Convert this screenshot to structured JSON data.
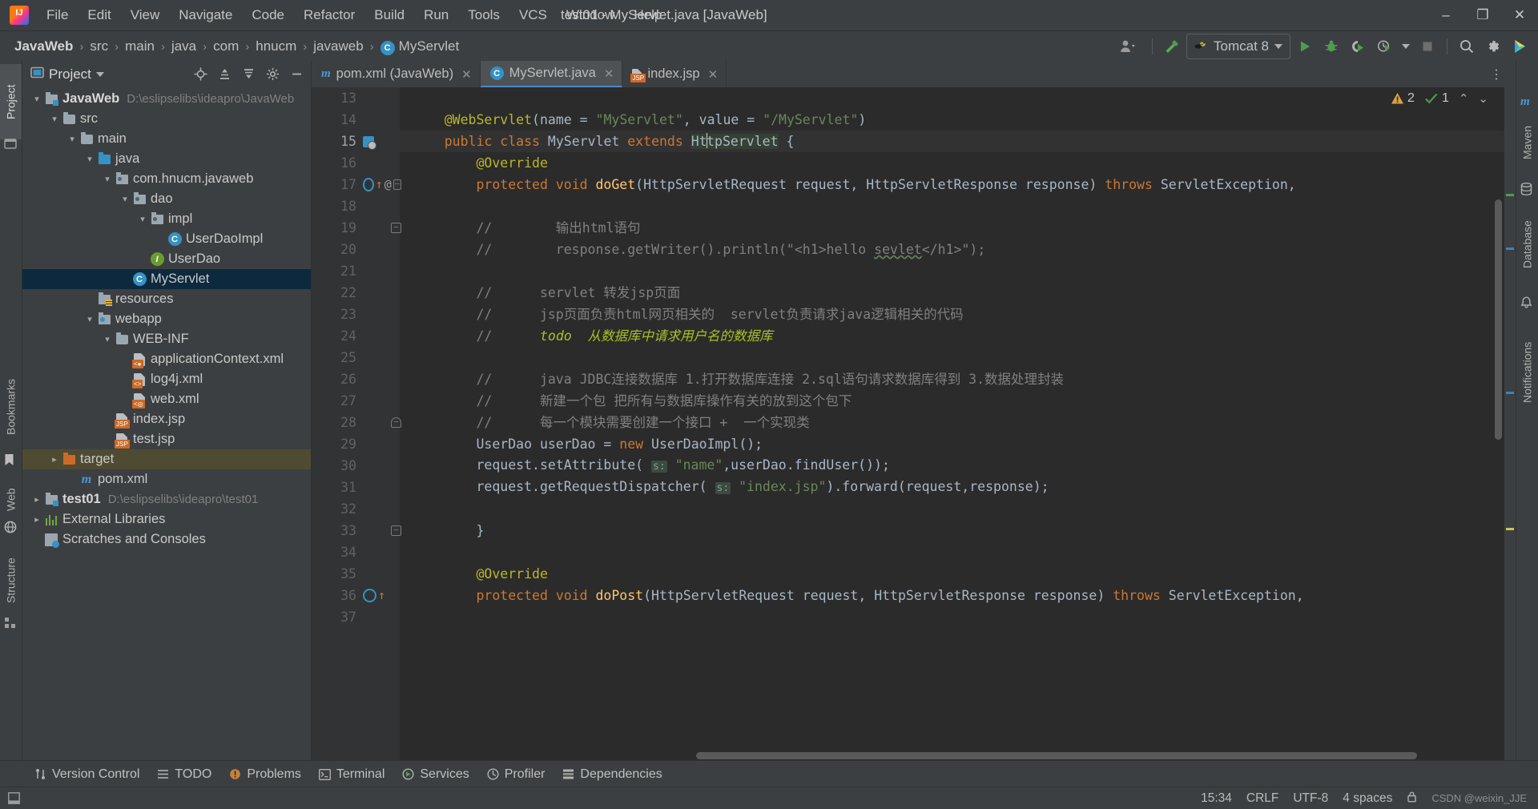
{
  "window": {
    "title": "test01 - MyServlet.java [JavaWeb]",
    "minimize": "–",
    "maximize": "❐",
    "close": "✕"
  },
  "menu": [
    {
      "label": "File"
    },
    {
      "label": "Edit"
    },
    {
      "label": "View"
    },
    {
      "label": "Navigate"
    },
    {
      "label": "Code"
    },
    {
      "label": "Refactor"
    },
    {
      "label": "Build"
    },
    {
      "label": "Run"
    },
    {
      "label": "Tools"
    },
    {
      "label": "VCS"
    },
    {
      "label": "Window"
    },
    {
      "label": "Help"
    }
  ],
  "breadcrumb": {
    "items": [
      "JavaWeb",
      "src",
      "main",
      "java",
      "com",
      "hnucm",
      "javaweb"
    ],
    "separator": "›",
    "current": "MyServlet",
    "current_badge": "C"
  },
  "toolbar": {
    "run_config": "Tomcat 8",
    "icons": [
      "user-icon",
      "hammer-icon",
      "run-icon",
      "debug-icon",
      "run-coverage-icon",
      "profile-icon",
      "stop-icon",
      "search-everywhere-icon",
      "settings-icon",
      "ide-assistant-icon"
    ]
  },
  "left_rail": {
    "tabs": [
      "Project",
      "Bookmarks",
      "Web",
      "Structure"
    ]
  },
  "right_rail": {
    "tabs": [
      "Maven",
      "Database",
      "Notifications"
    ]
  },
  "project_panel": {
    "title": "Project",
    "header_icons": [
      "locate-icon",
      "expand-all-icon",
      "collapse-all-icon",
      "settings-icon",
      "hide-icon"
    ],
    "tree": [
      {
        "depth": 0,
        "arrow": "v",
        "icon": "module-folder",
        "label": "JavaWeb",
        "path": "D:\\eslipselibs\\ideapro\\JavaWeb",
        "bold": true,
        "state": "normal"
      },
      {
        "depth": 1,
        "arrow": "v",
        "icon": "folder",
        "label": "src",
        "path": "",
        "bold": false,
        "state": "normal"
      },
      {
        "depth": 2,
        "arrow": "v",
        "icon": "folder",
        "label": "main",
        "path": "",
        "bold": false,
        "state": "normal"
      },
      {
        "depth": 3,
        "arrow": "v",
        "icon": "source-folder",
        "label": "java",
        "path": "",
        "bold": false,
        "state": "normal"
      },
      {
        "depth": 4,
        "arrow": "v",
        "icon": "package",
        "label": "com.hnucm.javaweb",
        "path": "",
        "bold": false,
        "state": "normal"
      },
      {
        "depth": 5,
        "arrow": "v",
        "icon": "package",
        "label": "dao",
        "path": "",
        "bold": false,
        "state": "normal"
      },
      {
        "depth": 6,
        "arrow": "v",
        "icon": "package",
        "label": "impl",
        "path": "",
        "bold": false,
        "state": "normal"
      },
      {
        "depth": 7,
        "arrow": "",
        "icon": "class",
        "label": "UserDaoImpl",
        "path": "",
        "bold": false,
        "state": "normal"
      },
      {
        "depth": 6,
        "arrow": "",
        "icon": "interface",
        "label": "UserDao",
        "path": "",
        "bold": false,
        "state": "normal"
      },
      {
        "depth": 5,
        "arrow": "",
        "icon": "class",
        "label": "MyServlet",
        "path": "",
        "bold": false,
        "state": "selected"
      },
      {
        "depth": 3,
        "arrow": "",
        "icon": "resource-folder",
        "label": "resources",
        "path": "",
        "bold": false,
        "state": "normal"
      },
      {
        "depth": 3,
        "arrow": "v",
        "icon": "web-folder",
        "label": "webapp",
        "path": "",
        "bold": false,
        "state": "normal"
      },
      {
        "depth": 4,
        "arrow": "v",
        "icon": "folder",
        "label": "WEB-INF",
        "path": "",
        "bold": false,
        "state": "normal"
      },
      {
        "depth": 5,
        "arrow": "",
        "icon": "xml-spring",
        "label": "applicationContext.xml",
        "path": "",
        "bold": false,
        "state": "normal"
      },
      {
        "depth": 5,
        "arrow": "",
        "icon": "xml-file",
        "label": "log4j.xml",
        "path": "",
        "bold": false,
        "state": "normal"
      },
      {
        "depth": 5,
        "arrow": "",
        "icon": "xml-web",
        "label": "web.xml",
        "path": "",
        "bold": false,
        "state": "normal"
      },
      {
        "depth": 4,
        "arrow": "",
        "icon": "jsp-file",
        "label": "index.jsp",
        "path": "",
        "bold": false,
        "state": "normal"
      },
      {
        "depth": 4,
        "arrow": "",
        "icon": "jsp-file",
        "label": "test.jsp",
        "path": "",
        "bold": false,
        "state": "normal"
      },
      {
        "depth": 1,
        "arrow": ">",
        "icon": "excluded-folder",
        "label": "target",
        "path": "",
        "bold": false,
        "state": "highlight"
      },
      {
        "depth": 2,
        "arrow": "",
        "icon": "maven",
        "label": "pom.xml",
        "path": "",
        "bold": false,
        "state": "normal"
      },
      {
        "depth": 0,
        "arrow": ">",
        "icon": "module-folder",
        "label": "test01",
        "path": "D:\\eslipselibs\\ideapro\\test01",
        "bold": true,
        "state": "normal"
      },
      {
        "depth": 0,
        "arrow": ">",
        "icon": "libraries",
        "label": "External Libraries",
        "path": "",
        "bold": false,
        "state": "normal"
      },
      {
        "depth": 0,
        "arrow": "",
        "icon": "scratches",
        "label": "Scratches and Consoles",
        "path": "",
        "bold": false,
        "state": "normal"
      }
    ]
  },
  "editor": {
    "tabs": [
      {
        "label": "pom.xml (JavaWeb)",
        "icon": "maven-icon",
        "active": false,
        "close": "✕"
      },
      {
        "label": "MyServlet.java",
        "icon": "class-icon",
        "active": true,
        "close": "✕"
      },
      {
        "label": "index.jsp",
        "icon": "jsp-icon",
        "active": false,
        "close": "✕"
      }
    ],
    "overflow": "⋮",
    "inspection": {
      "warning_count": "2",
      "warning_icon": "warning-triangle-icon",
      "ok_count": "1",
      "ok_icon": "checkmark-icon",
      "up_arrow": "⌃",
      "down_arrow": "⌄"
    },
    "first_line": 13,
    "lines": [
      {
        "no": 13,
        "markers": [],
        "fold": "",
        "tokens": []
      },
      {
        "no": 14,
        "markers": [],
        "fold": "",
        "tokens": [
          {
            "t": "    ",
            "c": ""
          },
          {
            "t": "@WebServlet",
            "c": "ann"
          },
          {
            "t": "(name = ",
            "c": "typ"
          },
          {
            "t": "\"MyServlet\"",
            "c": "str"
          },
          {
            "t": ", value = ",
            "c": "typ"
          },
          {
            "t": "\"/MyServlet\"",
            "c": "str"
          },
          {
            "t": ")",
            "c": "typ"
          }
        ]
      },
      {
        "no": 15,
        "markers": [
          "impl-icon"
        ],
        "fold": "",
        "current": true,
        "tokens": [
          {
            "t": "    ",
            "c": ""
          },
          {
            "t": "public ",
            "c": "kw"
          },
          {
            "t": "class ",
            "c": "kw"
          },
          {
            "t": "MyServlet ",
            "c": "typ"
          },
          {
            "t": "extends ",
            "c": "kw"
          },
          {
            "t": "HttpServlet",
            "c": "sel-tok"
          },
          {
            "t": " {",
            "c": "typ"
          }
        ]
      },
      {
        "no": 16,
        "markers": [],
        "fold": "",
        "tokens": [
          {
            "t": "        ",
            "c": ""
          },
          {
            "t": "@Override",
            "c": "ann"
          }
        ]
      },
      {
        "no": 17,
        "markers": [
          "override-icon",
          "up-arrow-icon",
          "at-icon"
        ],
        "fold": "-",
        "tokens": [
          {
            "t": "        ",
            "c": ""
          },
          {
            "t": "protected ",
            "c": "kw"
          },
          {
            "t": "void ",
            "c": "kw"
          },
          {
            "t": "doGet",
            "c": "fn"
          },
          {
            "t": "(HttpServletRequest request, HttpServletResponse response) ",
            "c": "typ"
          },
          {
            "t": "throws ",
            "c": "kw"
          },
          {
            "t": "ServletException,",
            "c": "typ"
          }
        ]
      },
      {
        "no": 18,
        "markers": [],
        "fold": "",
        "tokens": []
      },
      {
        "no": 19,
        "markers": [],
        "fold": "-",
        "tokens": [
          {
            "t": "        //        输出html语句",
            "c": "cmt"
          }
        ]
      },
      {
        "no": 20,
        "markers": [],
        "fold": "",
        "tokens": [
          {
            "t": "        //        response.getWriter().println(\"<h1>hello ",
            "c": "cmt"
          },
          {
            "t": "sevlet",
            "c": "cmt squig2"
          },
          {
            "t": "</h1>\");",
            "c": "cmt"
          }
        ]
      },
      {
        "no": 21,
        "markers": [],
        "fold": "",
        "tokens": []
      },
      {
        "no": 22,
        "markers": [],
        "fold": "",
        "tokens": [
          {
            "t": "        //      servlet 转发jsp页面",
            "c": "cmt"
          }
        ]
      },
      {
        "no": 23,
        "markers": [],
        "fold": "",
        "tokens": [
          {
            "t": "        //      jsp页面负责html网页相关的  servlet负责请求java逻辑相关的代码",
            "c": "cmt"
          }
        ]
      },
      {
        "no": 24,
        "markers": [],
        "fold": "",
        "tokens": [
          {
            "t": "        //      ",
            "c": "cmt"
          },
          {
            "t": "todo  从数据库中请求用户名的数据库",
            "c": "todo"
          }
        ]
      },
      {
        "no": 25,
        "markers": [],
        "fold": "",
        "tokens": []
      },
      {
        "no": 26,
        "markers": [],
        "fold": "",
        "tokens": [
          {
            "t": "        //      java JDBC连接数据库 1.打开数据库连接 2.sql语句请求数据库得到 3.数据处理封装",
            "c": "cmt"
          }
        ]
      },
      {
        "no": 27,
        "markers": [],
        "fold": "",
        "tokens": [
          {
            "t": "        //      新建一个包 把所有与数据库操作有关的放到这个包下",
            "c": "cmt"
          }
        ]
      },
      {
        "no": 28,
        "markers": [],
        "fold": "f",
        "tokens": [
          {
            "t": "        //      每一个模块需要创建一个接口 +  一个实现类",
            "c": "cmt"
          }
        ]
      },
      {
        "no": 29,
        "markers": [],
        "fold": "",
        "tokens": [
          {
            "t": "        UserDao userDao = ",
            "c": "typ"
          },
          {
            "t": "new ",
            "c": "kw"
          },
          {
            "t": "UserDaoImpl",
            "c": "typ"
          },
          {
            "t": "();",
            "c": "typ"
          }
        ]
      },
      {
        "no": 30,
        "markers": [],
        "fold": "",
        "tokens": [
          {
            "t": "        request.",
            "c": "typ"
          },
          {
            "t": "setAttribute",
            "c": "typ"
          },
          {
            "t": "( ",
            "c": "typ"
          },
          {
            "t": "s:",
            "c": "hint"
          },
          {
            "t": " ",
            "c": "typ"
          },
          {
            "t": "\"name\"",
            "c": "str"
          },
          {
            "t": ",userDao.",
            "c": "typ"
          },
          {
            "t": "findUser",
            "c": "typ"
          },
          {
            "t": "());",
            "c": "typ"
          }
        ]
      },
      {
        "no": 31,
        "markers": [],
        "fold": "",
        "tokens": [
          {
            "t": "        request.",
            "c": "typ"
          },
          {
            "t": "getRequestDispatcher",
            "c": "typ"
          },
          {
            "t": "( ",
            "c": "typ"
          },
          {
            "t": "s:",
            "c": "hint"
          },
          {
            "t": " ",
            "c": "typ"
          },
          {
            "t": "\"index.jsp\"",
            "c": "str"
          },
          {
            "t": ").",
            "c": "typ"
          },
          {
            "t": "forward",
            "c": "typ"
          },
          {
            "t": "(request,response);",
            "c": "typ"
          }
        ]
      },
      {
        "no": 32,
        "markers": [],
        "fold": "",
        "tokens": []
      },
      {
        "no": 33,
        "markers": [],
        "fold": "-",
        "tokens": [
          {
            "t": "        }",
            "c": "typ"
          }
        ]
      },
      {
        "no": 34,
        "markers": [],
        "fold": "",
        "tokens": []
      },
      {
        "no": 35,
        "markers": [],
        "fold": "",
        "tokens": [
          {
            "t": "        ",
            "c": ""
          },
          {
            "t": "@Override",
            "c": "ann"
          }
        ]
      },
      {
        "no": 36,
        "markers": [
          "override-icon",
          "up-arrow-icon"
        ],
        "fold": "",
        "tokens": [
          {
            "t": "        ",
            "c": ""
          },
          {
            "t": "protected ",
            "c": "kw"
          },
          {
            "t": "void ",
            "c": "kw"
          },
          {
            "t": "doPost",
            "c": "fn"
          },
          {
            "t": "(HttpServletRequest request, HttpServletResponse response) ",
            "c": "typ"
          },
          {
            "t": "throws ",
            "c": "kw"
          },
          {
            "t": "ServletException,",
            "c": "typ"
          }
        ]
      },
      {
        "no": 37,
        "markers": [],
        "fold": "",
        "tokens": []
      }
    ]
  },
  "bottom_tools": [
    {
      "label": "Version Control",
      "icon": "vcs-icon"
    },
    {
      "label": "TODO",
      "icon": "todo-icon"
    },
    {
      "label": "Problems",
      "icon": "problems-icon"
    },
    {
      "label": "Terminal",
      "icon": "terminal-icon"
    },
    {
      "label": "Services",
      "icon": "services-icon"
    },
    {
      "label": "Profiler",
      "icon": "profiler-icon"
    },
    {
      "label": "Dependencies",
      "icon": "dependencies-icon"
    }
  ],
  "status_bar": {
    "time": "15:34",
    "line_sep": "CRLF",
    "encoding": "UTF-8",
    "indent": "4 spaces",
    "lock_icon": "lock-icon",
    "event_icon": "event-log-icon",
    "watermark": "CSDN @weixin_JJE"
  },
  "colors": {
    "accent_blue": "#3592c4",
    "selection_bg": "#0d293e",
    "editor_bg": "#2b2b2b",
    "panel_bg": "#3c3f41",
    "gutter_bg": "#313335",
    "excluded": "#4f4b33"
  }
}
